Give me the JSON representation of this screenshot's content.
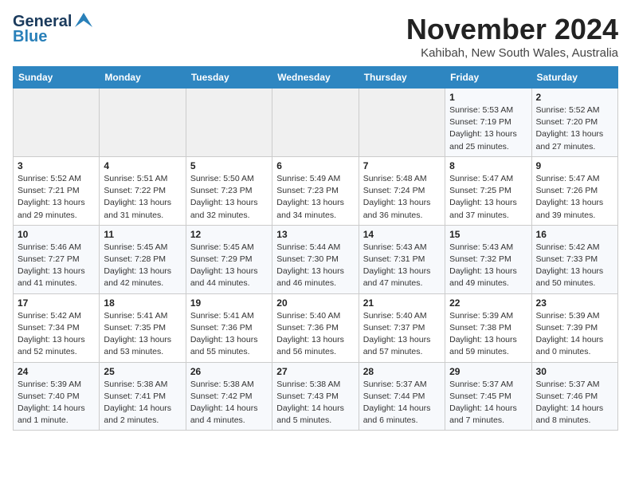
{
  "header": {
    "logo_general": "General",
    "logo_blue": "Blue",
    "month_title": "November 2024",
    "location": "Kahibah, New South Wales, Australia"
  },
  "days_of_week": [
    "Sunday",
    "Monday",
    "Tuesday",
    "Wednesday",
    "Thursday",
    "Friday",
    "Saturday"
  ],
  "weeks": [
    [
      {
        "day": "",
        "info": ""
      },
      {
        "day": "",
        "info": ""
      },
      {
        "day": "",
        "info": ""
      },
      {
        "day": "",
        "info": ""
      },
      {
        "day": "",
        "info": ""
      },
      {
        "day": "1",
        "info": "Sunrise: 5:53 AM\nSunset: 7:19 PM\nDaylight: 13 hours\nand 25 minutes."
      },
      {
        "day": "2",
        "info": "Sunrise: 5:52 AM\nSunset: 7:20 PM\nDaylight: 13 hours\nand 27 minutes."
      }
    ],
    [
      {
        "day": "3",
        "info": "Sunrise: 5:52 AM\nSunset: 7:21 PM\nDaylight: 13 hours\nand 29 minutes."
      },
      {
        "day": "4",
        "info": "Sunrise: 5:51 AM\nSunset: 7:22 PM\nDaylight: 13 hours\nand 31 minutes."
      },
      {
        "day": "5",
        "info": "Sunrise: 5:50 AM\nSunset: 7:23 PM\nDaylight: 13 hours\nand 32 minutes."
      },
      {
        "day": "6",
        "info": "Sunrise: 5:49 AM\nSunset: 7:23 PM\nDaylight: 13 hours\nand 34 minutes."
      },
      {
        "day": "7",
        "info": "Sunrise: 5:48 AM\nSunset: 7:24 PM\nDaylight: 13 hours\nand 36 minutes."
      },
      {
        "day": "8",
        "info": "Sunrise: 5:47 AM\nSunset: 7:25 PM\nDaylight: 13 hours\nand 37 minutes."
      },
      {
        "day": "9",
        "info": "Sunrise: 5:47 AM\nSunset: 7:26 PM\nDaylight: 13 hours\nand 39 minutes."
      }
    ],
    [
      {
        "day": "10",
        "info": "Sunrise: 5:46 AM\nSunset: 7:27 PM\nDaylight: 13 hours\nand 41 minutes."
      },
      {
        "day": "11",
        "info": "Sunrise: 5:45 AM\nSunset: 7:28 PM\nDaylight: 13 hours\nand 42 minutes."
      },
      {
        "day": "12",
        "info": "Sunrise: 5:45 AM\nSunset: 7:29 PM\nDaylight: 13 hours\nand 44 minutes."
      },
      {
        "day": "13",
        "info": "Sunrise: 5:44 AM\nSunset: 7:30 PM\nDaylight: 13 hours\nand 46 minutes."
      },
      {
        "day": "14",
        "info": "Sunrise: 5:43 AM\nSunset: 7:31 PM\nDaylight: 13 hours\nand 47 minutes."
      },
      {
        "day": "15",
        "info": "Sunrise: 5:43 AM\nSunset: 7:32 PM\nDaylight: 13 hours\nand 49 minutes."
      },
      {
        "day": "16",
        "info": "Sunrise: 5:42 AM\nSunset: 7:33 PM\nDaylight: 13 hours\nand 50 minutes."
      }
    ],
    [
      {
        "day": "17",
        "info": "Sunrise: 5:42 AM\nSunset: 7:34 PM\nDaylight: 13 hours\nand 52 minutes."
      },
      {
        "day": "18",
        "info": "Sunrise: 5:41 AM\nSunset: 7:35 PM\nDaylight: 13 hours\nand 53 minutes."
      },
      {
        "day": "19",
        "info": "Sunrise: 5:41 AM\nSunset: 7:36 PM\nDaylight: 13 hours\nand 55 minutes."
      },
      {
        "day": "20",
        "info": "Sunrise: 5:40 AM\nSunset: 7:36 PM\nDaylight: 13 hours\nand 56 minutes."
      },
      {
        "day": "21",
        "info": "Sunrise: 5:40 AM\nSunset: 7:37 PM\nDaylight: 13 hours\nand 57 minutes."
      },
      {
        "day": "22",
        "info": "Sunrise: 5:39 AM\nSunset: 7:38 PM\nDaylight: 13 hours\nand 59 minutes."
      },
      {
        "day": "23",
        "info": "Sunrise: 5:39 AM\nSunset: 7:39 PM\nDaylight: 14 hours\nand 0 minutes."
      }
    ],
    [
      {
        "day": "24",
        "info": "Sunrise: 5:39 AM\nSunset: 7:40 PM\nDaylight: 14 hours\nand 1 minute."
      },
      {
        "day": "25",
        "info": "Sunrise: 5:38 AM\nSunset: 7:41 PM\nDaylight: 14 hours\nand 2 minutes."
      },
      {
        "day": "26",
        "info": "Sunrise: 5:38 AM\nSunset: 7:42 PM\nDaylight: 14 hours\nand 4 minutes."
      },
      {
        "day": "27",
        "info": "Sunrise: 5:38 AM\nSunset: 7:43 PM\nDaylight: 14 hours\nand 5 minutes."
      },
      {
        "day": "28",
        "info": "Sunrise: 5:37 AM\nSunset: 7:44 PM\nDaylight: 14 hours\nand 6 minutes."
      },
      {
        "day": "29",
        "info": "Sunrise: 5:37 AM\nSunset: 7:45 PM\nDaylight: 14 hours\nand 7 minutes."
      },
      {
        "day": "30",
        "info": "Sunrise: 5:37 AM\nSunset: 7:46 PM\nDaylight: 14 hours\nand 8 minutes."
      }
    ]
  ]
}
